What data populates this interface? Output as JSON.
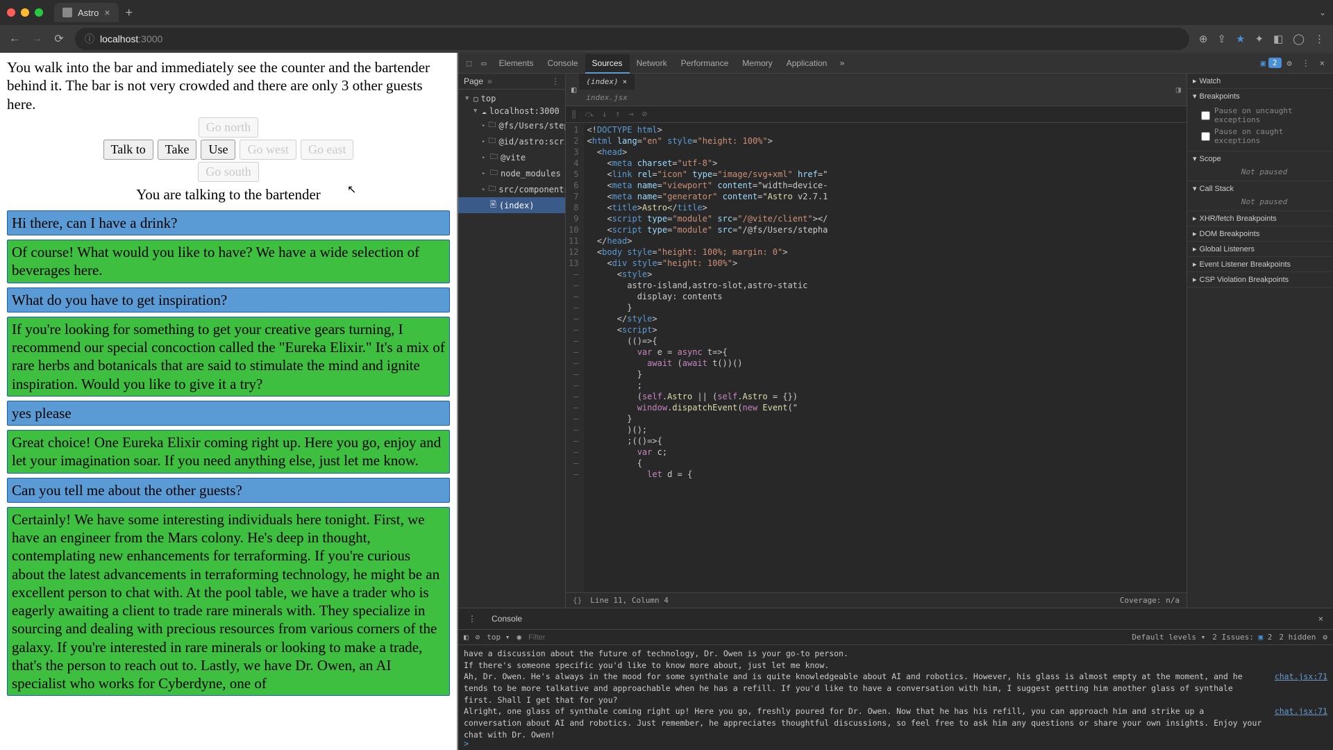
{
  "browser": {
    "tab_title": "Astro",
    "url_host": "localhost",
    "url_port": ":3000"
  },
  "game": {
    "description": "You walk into the bar and immediately see the counter and the bartender behind it. The bar is not very crowded and there are only 3 other guests here.",
    "buttons": {
      "talk": "Talk to",
      "take": "Take",
      "use": "Use",
      "north": "Go north",
      "west": "Go west",
      "east": "Go east",
      "south": "Go south"
    },
    "status": "You are talking to the bartender",
    "messages": [
      {
        "role": "user",
        "text": "Hi there, can I have a drink?"
      },
      {
        "role": "npc",
        "text": "Of course! What would you like to have? We have a wide selection of beverages here."
      },
      {
        "role": "user",
        "text": "What do you have to get inspiration?"
      },
      {
        "role": "npc",
        "text": "If you're looking for something to get your creative gears turning, I recommend our special concoction called the \"Eureka Elixir.\" It's a mix of rare herbs and botanicals that are said to stimulate the mind and ignite inspiration. Would you like to give it a try?"
      },
      {
        "role": "user",
        "text": "yes please"
      },
      {
        "role": "npc",
        "text": "Great choice! One Eureka Elixir coming right up. Here you go, enjoy and let your imagination soar. If you need anything else, just let me know."
      },
      {
        "role": "user",
        "text": "Can you tell me about the other guests?"
      },
      {
        "role": "npc",
        "text": "Certainly! We have some interesting individuals here tonight. First, we have an engineer from the Mars colony. He's deep in thought, contemplating new enhancements for terraforming. If you're curious about the latest advancements in terraforming technology, he might be an excellent person to chat with. At the pool table, we have a trader who is eagerly awaiting a client to trade rare minerals with. They specialize in sourcing and dealing with precious resources from various corners of the galaxy. If you're interested in rare minerals or looking to make a trade, that's the person to reach out to. Lastly, we have Dr. Owen, an AI specialist who works for Cyberdyne, one of"
      }
    ]
  },
  "devtools": {
    "tabs": [
      "Elements",
      "Console",
      "Sources",
      "Network",
      "Performance",
      "Memory",
      "Application"
    ],
    "active_tab": "Sources",
    "issues_badge": "2",
    "page_tab": "Page",
    "file_tree": {
      "top": "top",
      "host": "localhost:3000",
      "folders": [
        "@fs/Users/stepha",
        "@id/astro:scripts",
        "@vite",
        "node_modules",
        "src/components"
      ],
      "file": "(index)"
    },
    "open_tabs": [
      {
        "name": "(index)",
        "active": true
      },
      {
        "name": "index.jsx",
        "active": false
      }
    ],
    "gutter": [
      "1",
      "2",
      "3",
      "4",
      "5",
      "6",
      "7",
      "8",
      "9",
      "10",
      "11",
      "12",
      "13",
      "—",
      "—",
      "—",
      "—",
      "—",
      "—",
      "—",
      "—",
      "—",
      "—",
      "—",
      "—",
      "—",
      "—",
      "—",
      "—",
      "—",
      "—",
      "—"
    ],
    "code_lines": [
      "<!DOCTYPE html>",
      "<html lang=\"en\" style=\"height: 100%\">",
      "  <head>",
      "    <meta charset=\"utf-8\">",
      "    <link rel=\"icon\" type=\"image/svg+xml\" href=\"",
      "    <meta name=\"viewport\" content=\"width=device-",
      "    <meta name=\"generator\" content=\"Astro v2.7.1",
      "    <title>Astro</title>",
      "    <script type=\"module\" src=\"/@vite/client\"></",
      "    <script type=\"module\" src=\"/@fs/Users/stepha",
      "  </head>",
      "  <body style=\"height: 100%; margin: 0\">",
      "    <div style=\"height: 100%\">",
      "      <style>",
      "        astro-island,astro-slot,astro-static",
      "          display: contents",
      "        }",
      "      </style>",
      "      <script>",
      "        (()=>{",
      "          var e = async t=>{",
      "            await (await t())()",
      "          }",
      "          ;",
      "          (self.Astro || (self.Astro = {})",
      "          window.dispatchEvent(new Event(\"",
      "        }",
      "        )();",
      "        ;(()=>{",
      "          var c;",
      "          {",
      "            let d = {"
    ],
    "status_line": "Line 11, Column 4",
    "coverage": "Coverage: n/a",
    "debug_sections": {
      "watch": "Watch",
      "breakpoints": "Breakpoints",
      "bp_uncaught": "Pause on uncaught exceptions",
      "bp_caught": "Pause on caught exceptions",
      "scope": "Scope",
      "scope_body": "Not paused",
      "callstack": "Call Stack",
      "callstack_body": "Not paused",
      "xhr": "XHR/fetch Breakpoints",
      "dom": "DOM Breakpoints",
      "global": "Global Listeners",
      "event": "Event Listener Breakpoints",
      "csp": "CSP Violation Breakpoints"
    }
  },
  "console": {
    "tab": "Console",
    "context": "top",
    "filter_placeholder": "Filter",
    "levels": "Default levels",
    "issues": "2 Issues:",
    "issues_count": "2",
    "hidden": "2 hidden",
    "lines": [
      {
        "text": "have a discussion about the future of technology, Dr. Owen is your go-to person.",
        "src": ""
      },
      {
        "text": "",
        "src": ""
      },
      {
        "text": "If there's someone specific you'd like to know more about, just let me know.",
        "src": ""
      },
      {
        "text": "Ah, Dr. Owen. He's always in the mood for some synthale and is quite knowledgeable about AI and robotics. However, his glass is almost empty at the moment, and he tends to be more talkative and approachable when he has a refill. If you'd like to have a conversation with him, I suggest getting him another glass of synthale first. Shall I get that for you?",
        "src": "chat.jsx:71"
      },
      {
        "text": "Alright, one glass of synthale coming right up! Here you go, freshly poured for Dr. Owen. Now that he has his refill, you can approach him and strike up a conversation about AI and robotics. Just remember, he appreciates thoughtful discussions, so feel free to ask him any questions or share your own insights. Enjoy your chat with Dr. Owen!",
        "src": "chat.jsx:71"
      }
    ],
    "prompt": ">"
  }
}
